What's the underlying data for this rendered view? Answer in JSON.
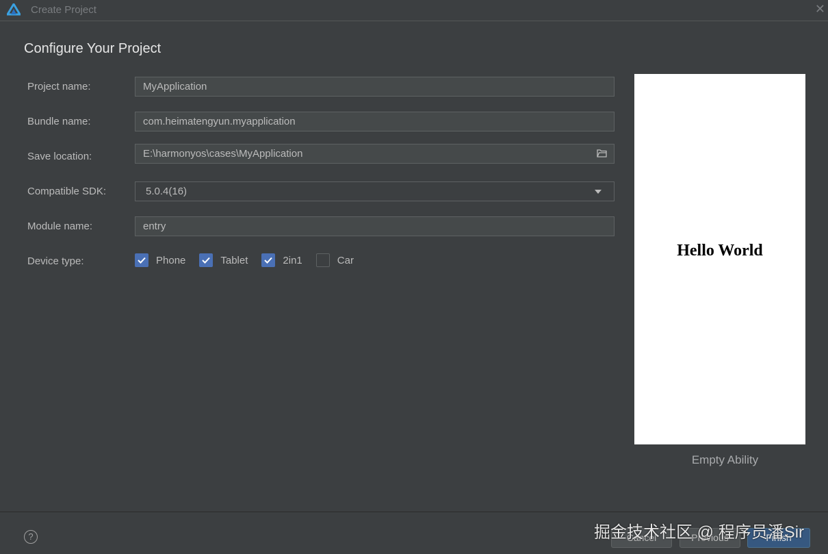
{
  "window": {
    "title": "Create Project",
    "accent": "#4a70b5"
  },
  "heading": "Configure Your Project",
  "form": {
    "project_name": {
      "label": "Project name:",
      "value": "MyApplication"
    },
    "bundle_name": {
      "label": "Bundle name:",
      "value": "com.heimatengyun.myapplication"
    },
    "save_location": {
      "label": "Save location:",
      "value": "E:\\harmonyos\\cases\\MyApplication"
    },
    "compatible_sdk": {
      "label": "Compatible SDK:",
      "value": "5.0.4(16)"
    },
    "module_name": {
      "label": "Module name:",
      "value": "entry"
    },
    "device_type": {
      "label": "Device type:",
      "options": [
        {
          "label": "Phone",
          "checked": true
        },
        {
          "label": "Tablet",
          "checked": true
        },
        {
          "label": "2in1",
          "checked": true
        },
        {
          "label": "Car",
          "checked": false
        }
      ]
    }
  },
  "preview": {
    "text": "Hello World",
    "template": "Empty Ability"
  },
  "footer": {
    "help": "?",
    "cancel": "Cancel",
    "previous": "Previous",
    "finish": "Finish"
  },
  "watermark": "掘金技术社区 @ 程序员潘Sir"
}
